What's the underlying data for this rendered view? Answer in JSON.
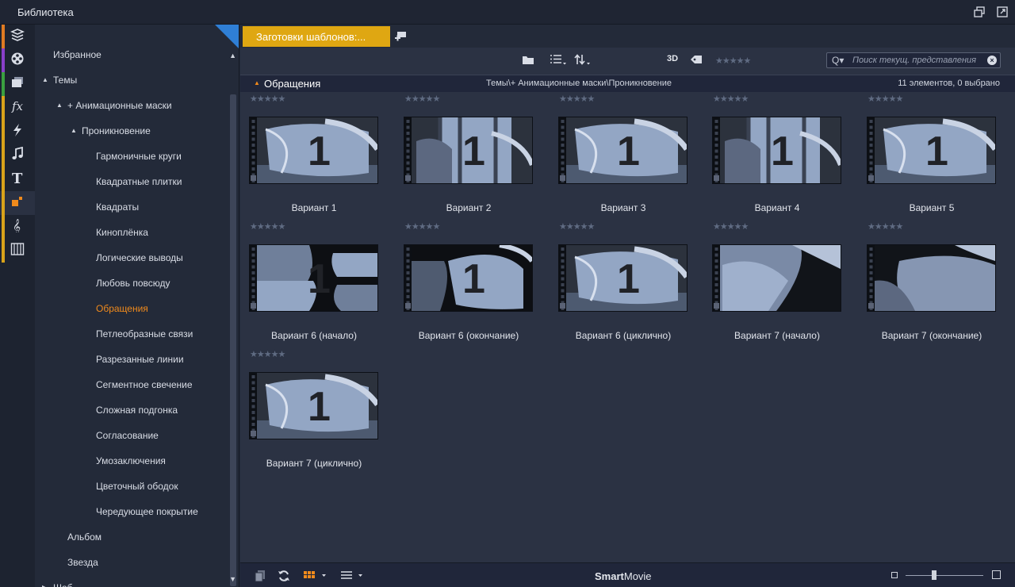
{
  "window": {
    "title": "Библиотека"
  },
  "tree": {
    "items": [
      {
        "label": "Избранное",
        "level": 0,
        "caret": ""
      },
      {
        "label": "Темы",
        "level": 0,
        "caret": "▲"
      },
      {
        "label": "+ Анимационные маски",
        "level": 1,
        "caret": "▲"
      },
      {
        "label": "Проникновение",
        "level": 2,
        "caret": "▲"
      },
      {
        "label": "Гармоничные круги",
        "level": 3
      },
      {
        "label": "Квадратные плитки",
        "level": 3
      },
      {
        "label": "Квадраты",
        "level": 3
      },
      {
        "label": "Киноплёнка",
        "level": 3
      },
      {
        "label": "Логические выводы",
        "level": 3
      },
      {
        "label": "Любовь повсюду",
        "level": 3
      },
      {
        "label": "Обращения",
        "level": 3,
        "selected": true
      },
      {
        "label": "Петлеобразные связи",
        "level": 3
      },
      {
        "label": "Разрезанные линии",
        "level": 3
      },
      {
        "label": "Сегментное свечение",
        "level": 3
      },
      {
        "label": "Сложная подгонка",
        "level": 3
      },
      {
        "label": "Согласование",
        "level": 3
      },
      {
        "label": "Умозаключения",
        "level": 3
      },
      {
        "label": "Цветочный ободок",
        "level": 3
      },
      {
        "label": "Чередующее покрытие",
        "level": 3
      },
      {
        "label": "Альбом",
        "level": 1
      },
      {
        "label": "Звезда",
        "level": 1
      },
      {
        "label": "Шаб",
        "level": 0,
        "caret": "▶"
      }
    ]
  },
  "tabs": {
    "active_label": "Заготовки шаблонов:..."
  },
  "toolbar": {
    "label_3d": "3D",
    "search_placeholder": "Поиск текущ. представления",
    "search_icon_text": "Q▾"
  },
  "pathbar": {
    "category": "Обращения",
    "path": "Темы\\+ Анимационные маски\\Проникновение",
    "count": "11 элементов, 0 выбрано"
  },
  "grid": {
    "items": [
      {
        "label": "Вариант 1",
        "variant": "a"
      },
      {
        "label": "Вариант 2",
        "variant": "b"
      },
      {
        "label": "Вариант 3",
        "variant": "a"
      },
      {
        "label": "Вариант 4",
        "variant": "b"
      },
      {
        "label": "Вариант 5",
        "variant": "a"
      },
      {
        "label": "Вариант 6 (начало)",
        "variant": "c"
      },
      {
        "label": "Вариант 6 (окончание)",
        "variant": "d"
      },
      {
        "label": "Вариант 6 (циклично)",
        "variant": "a"
      },
      {
        "label": "Вариант 7 (начало)",
        "variant": "e"
      },
      {
        "label": "Вариант 7 (окончание)",
        "variant": "f"
      },
      {
        "label": "Вариант 7 (циклично)",
        "variant": "a"
      }
    ],
    "stars": "★★★★★"
  },
  "bottombar": {
    "brand_bold": "Smart",
    "brand_rest": "Movie"
  },
  "colors": {
    "accent": "#dfa712",
    "selection": "#f08a1c",
    "corner": "#2f7fd6"
  },
  "iconbar": [
    {
      "name": "project-bin-icon",
      "stripe": "#e07b22"
    },
    {
      "name": "film-reel-icon",
      "stripe": "#8a3fc9"
    },
    {
      "name": "photos-icon",
      "stripe": "#3aa040"
    },
    {
      "name": "effects-fx-icon",
      "stripe": "#d9a31a"
    },
    {
      "name": "transitions-icon",
      "stripe": "#d9a31a"
    },
    {
      "name": "music-icon",
      "stripe": "#d9a31a"
    },
    {
      "name": "titles-icon",
      "stripe": "#d9a31a"
    },
    {
      "name": "montage-icon",
      "stripe": "#d9a31a"
    },
    {
      "name": "sound-effects-icon",
      "stripe": "#d9a31a"
    },
    {
      "name": "piano-icon",
      "stripe": "#d9a31a"
    }
  ]
}
